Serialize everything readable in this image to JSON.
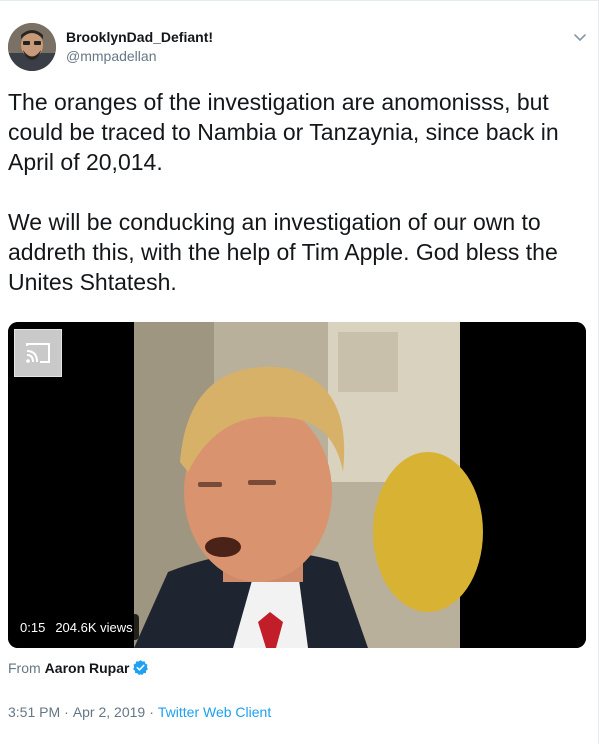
{
  "tweet": {
    "display_name": "BrooklynDad_Defiant!",
    "handle": "@mmpadellan",
    "text": "The oranges of the investigation are anomonisss, but could be traced to Nambia or Tanzaynia, since back in April of 20,014.\n\nWe will be conducking an investigation of our own to addreth this, with the help of Tim Apple. God bless the Unites Shtatesh.",
    "menu_icon": "chevron-down-icon"
  },
  "media": {
    "duration": "0:15",
    "views": "204.6K views",
    "cast_icon": "cast-icon"
  },
  "attribution": {
    "prefix": "From",
    "author": "Aaron Rupar"
  },
  "meta": {
    "time": "3:51 PM",
    "date": "Apr 2, 2019",
    "client": "Twitter Web Client"
  },
  "colors": {
    "link_blue": "#1da1f2",
    "text_gray": "#657786",
    "verified_blue": "#1da1f2"
  }
}
